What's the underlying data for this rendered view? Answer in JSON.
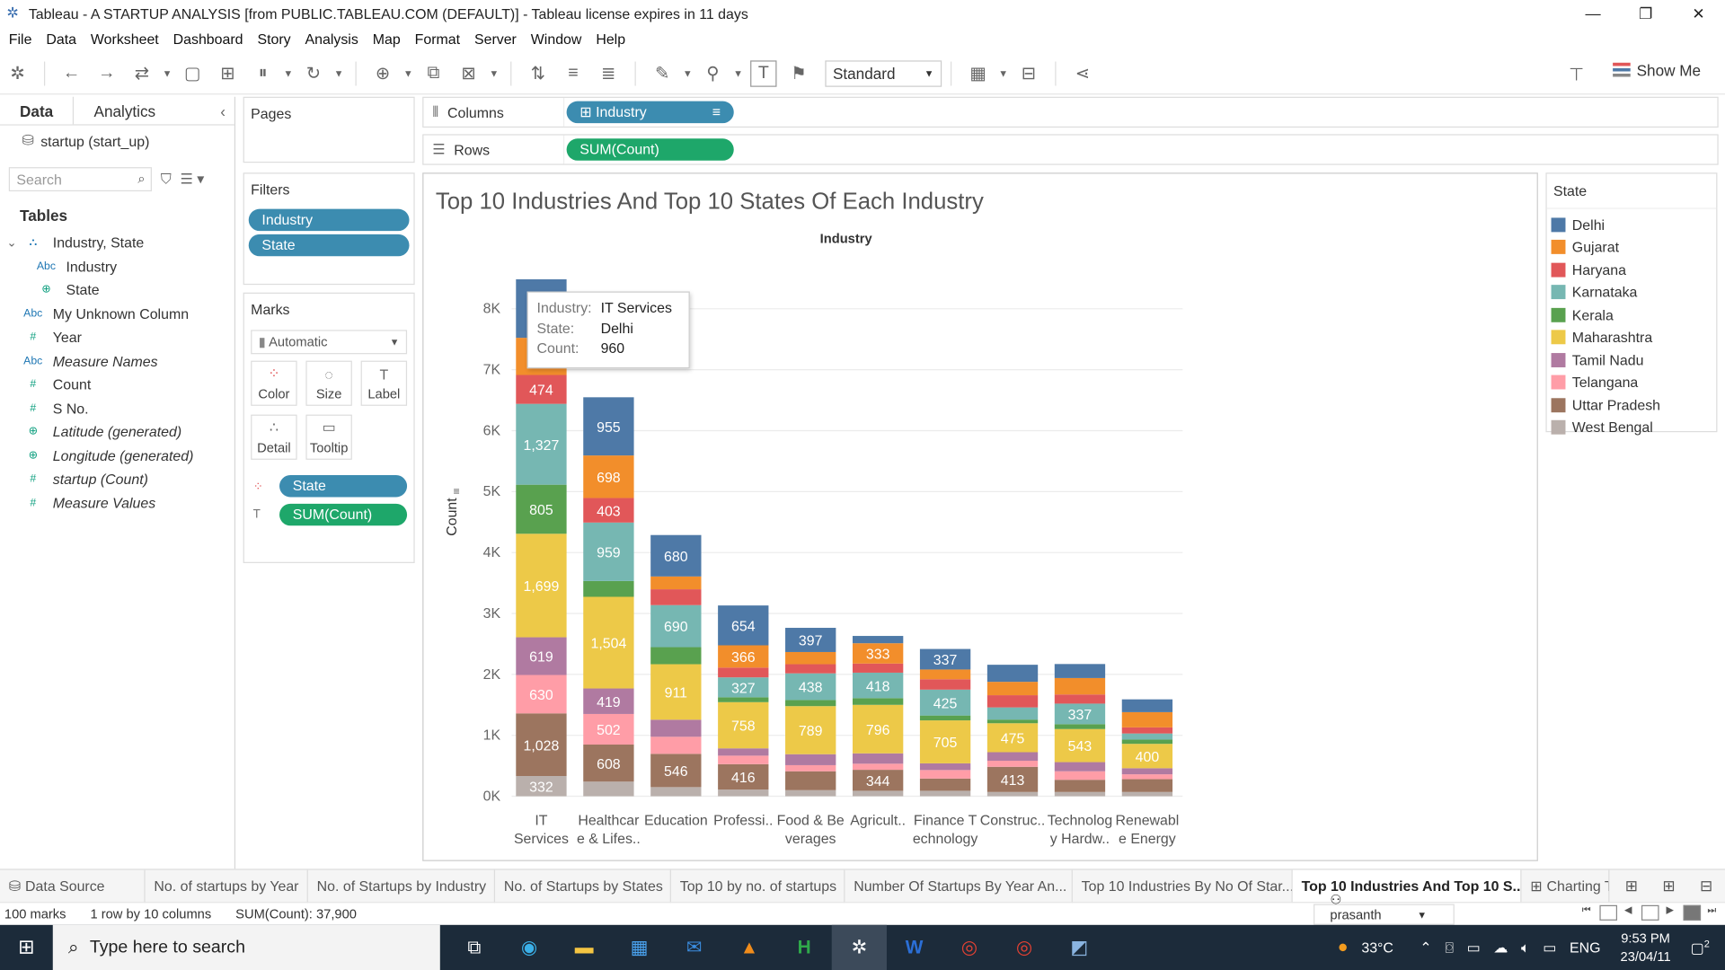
{
  "window": {
    "title": "Tableau - A STARTUP ANALYSIS [from PUBLIC.TABLEAU.COM (DEFAULT)] - Tableau license expires in 11 days",
    "controls": {
      "minimize": "—",
      "restore": "❐",
      "close": "✕"
    }
  },
  "menu": [
    "File",
    "Data",
    "Worksheet",
    "Dashboard",
    "Story",
    "Analysis",
    "Map",
    "Format",
    "Server",
    "Window",
    "Help"
  ],
  "toolbar": {
    "fit_select": "Standard",
    "show_me": "Show Me"
  },
  "data_pane": {
    "tabs": [
      "Data",
      "Analytics"
    ],
    "datasource": "startup (start_up)",
    "search_placeholder": "Search",
    "tables_label": "Tables",
    "fields": [
      {
        "icon": "hierarchy",
        "label": "Industry, State",
        "indent": 0
      },
      {
        "icon": "Abc",
        "label": "Industry",
        "indent": 1
      },
      {
        "icon": "globe",
        "label": "State",
        "indent": 1
      },
      {
        "icon": "Abc",
        "label": "My Unknown Column",
        "indent": 0
      },
      {
        "icon": "#",
        "label": "Year",
        "indent": 0
      },
      {
        "icon": "Abc",
        "label": "Measure Names",
        "indent": 0,
        "italic": true
      },
      {
        "icon": "#",
        "label": "Count",
        "indent": 0
      },
      {
        "icon": "#",
        "label": "S No.",
        "indent": 0
      },
      {
        "icon": "globe",
        "label": "Latitude (generated)",
        "indent": 0,
        "italic": true
      },
      {
        "icon": "globe",
        "label": "Longitude (generated)",
        "indent": 0,
        "italic": true
      },
      {
        "icon": "#",
        "label": "startup (Count)",
        "indent": 0,
        "italic": true
      },
      {
        "icon": "#",
        "label": "Measure Values",
        "indent": 0,
        "italic": true
      }
    ]
  },
  "cards": {
    "pages": "Pages",
    "filters": {
      "title": "Filters",
      "pills": [
        "Industry",
        "State"
      ]
    },
    "marks": {
      "title": "Marks",
      "type": "Automatic",
      "buttons": [
        "Color",
        "Size",
        "Label",
        "Detail",
        "Tooltip"
      ],
      "pills": [
        "State",
        "SUM(Count)"
      ]
    }
  },
  "shelves": {
    "columns_label": "Columns",
    "columns_pill": "Industry",
    "rows_label": "Rows",
    "rows_pill": "SUM(Count)"
  },
  "viz": {
    "title": "Top 10 Industries And Top 10 States Of Each Industry",
    "header": "Industry",
    "y_axis_title": "Count"
  },
  "tooltip": {
    "rows": [
      {
        "k": "Industry:",
        "v": "IT Services"
      },
      {
        "k": "State:",
        "v": "Delhi"
      },
      {
        "k": "Count:",
        "v": "960"
      }
    ]
  },
  "legend": {
    "title": "State",
    "items": [
      {
        "label": "Delhi",
        "color": "#4e79a7"
      },
      {
        "label": "Gujarat",
        "color": "#f28e2b"
      },
      {
        "label": "Haryana",
        "color": "#e15759"
      },
      {
        "label": "Karnataka",
        "color": "#76b7b2"
      },
      {
        "label": "Kerala",
        "color": "#59a14f"
      },
      {
        "label": "Maharashtra",
        "color": "#edc948"
      },
      {
        "label": "Tamil Nadu",
        "color": "#b07aa1"
      },
      {
        "label": "Telangana",
        "color": "#ff9da7"
      },
      {
        "label": "Uttar Pradesh",
        "color": "#9c755f"
      },
      {
        "label": "West Bengal",
        "color": "#bab0ac"
      }
    ]
  },
  "chart_data": {
    "type": "bar",
    "stacked": true,
    "title": "Top 10 Industries And Top 10 States Of Each Industry",
    "xlabel": "Industry",
    "ylabel": "Count",
    "ylim": [
      0,
      8700
    ],
    "yticks": [
      0,
      1000,
      2000,
      3000,
      4000,
      5000,
      6000,
      7000,
      8000
    ],
    "ytick_labels": [
      "0K",
      "1K",
      "2K",
      "3K",
      "4K",
      "5K",
      "6K",
      "7K",
      "8K"
    ],
    "categories": [
      [
        "IT",
        "Services"
      ],
      [
        "Healthcar",
        "e & Lifes.."
      ],
      [
        "Education"
      ],
      [
        "Professi.."
      ],
      [
        "Food & Be",
        "verages"
      ],
      [
        "Agricult.."
      ],
      [
        "Finance T",
        "echnology"
      ],
      [
        "Construc.."
      ],
      [
        "Technolog",
        "y Hardw.."
      ],
      [
        "Renewabl",
        "e Energy"
      ]
    ],
    "stack_order_bottom_to_top": [
      "West Bengal",
      "Uttar Pradesh",
      "Telangana",
      "Tamil Nadu",
      "Maharashtra",
      "Kerala",
      "Karnataka",
      "Haryana",
      "Gujarat",
      "Delhi"
    ],
    "series": [
      {
        "name": "West Bengal",
        "values": [
          332,
          240,
          150,
          110,
          100,
          90,
          90,
          70,
          70,
          70
        ],
        "show_labels": [
          true,
          false,
          false,
          false,
          false,
          false,
          false,
          false,
          false,
          false
        ]
      },
      {
        "name": "Uttar Pradesh",
        "values": [
          1028,
          608,
          546,
          416,
          310,
          344,
          200,
          413,
          200,
          210
        ],
        "show_labels": [
          true,
          true,
          true,
          true,
          false,
          true,
          false,
          true,
          false,
          false
        ]
      },
      {
        "name": "Telangana",
        "values": [
          630,
          502,
          280,
          140,
          100,
          100,
          140,
          100,
          140,
          80
        ],
        "show_labels": [
          true,
          true,
          false,
          false,
          false,
          false,
          false,
          false,
          false,
          false
        ]
      },
      {
        "name": "Tamil Nadu",
        "values": [
          619,
          419,
          280,
          120,
          180,
          170,
          110,
          140,
          150,
          100
        ],
        "show_labels": [
          true,
          true,
          false,
          false,
          false,
          false,
          false,
          false,
          false,
          false
        ]
      },
      {
        "name": "Maharashtra",
        "values": [
          1699,
          1504,
          911,
          758,
          789,
          796,
          705,
          475,
          543,
          400
        ],
        "show_labels": [
          true,
          true,
          true,
          true,
          true,
          true,
          true,
          true,
          true,
          true
        ]
      },
      {
        "name": "Kerala",
        "values": [
          805,
          260,
          280,
          80,
          100,
          110,
          80,
          60,
          80,
          70
        ],
        "show_labels": [
          true,
          false,
          false,
          false,
          false,
          false,
          false,
          false,
          false,
          false
        ]
      },
      {
        "name": "Karnataka",
        "values": [
          1327,
          959,
          690,
          327,
          438,
          418,
          425,
          200,
          337,
          100
        ],
        "show_labels": [
          true,
          true,
          true,
          true,
          true,
          true,
          true,
          false,
          true,
          false
        ]
      },
      {
        "name": "Haryana",
        "values": [
          474,
          403,
          260,
          160,
          150,
          150,
          170,
          200,
          150,
          100
        ],
        "show_labels": [
          true,
          true,
          false,
          false,
          false,
          false,
          false,
          false,
          false,
          false
        ]
      },
      {
        "name": "Gujarat",
        "values": [
          610,
          698,
          210,
          366,
          200,
          333,
          160,
          220,
          270,
          250
        ],
        "show_labels": [
          false,
          true,
          false,
          true,
          false,
          true,
          false,
          false,
          false,
          false
        ]
      },
      {
        "name": "Delhi",
        "values": [
          960,
          955,
          680,
          654,
          397,
          120,
          337,
          280,
          230,
          210
        ],
        "show_labels": [
          false,
          true,
          true,
          true,
          true,
          false,
          true,
          false,
          false,
          false
        ]
      }
    ]
  },
  "sheet_tabs": [
    {
      "label": "Data Source",
      "active": false
    },
    {
      "label": "No. of startups by Year",
      "active": false
    },
    {
      "label": "No. of Startups by Industry",
      "active": false
    },
    {
      "label": "No. of Startups by States",
      "active": false
    },
    {
      "label": "Top 10 by no. of startups",
      "active": false
    },
    {
      "label": "Number Of Startups By Year An...",
      "active": false
    },
    {
      "label": "Top 10 Industries By No Of Star...",
      "active": false
    },
    {
      "label": "Top 10 Industries And Top 10 S...",
      "active": true
    },
    {
      "label": "Charting T",
      "active": false
    }
  ],
  "status": {
    "marks": "100 marks",
    "dims": "1 row by 10 columns",
    "sum": "SUM(Count): 37,900",
    "user": "prasanth k"
  },
  "taskbar": {
    "search_placeholder": "Type here to search",
    "weather": "33°C",
    "lang": "ENG",
    "time": "9:53 PM",
    "date": "23/04/11",
    "notif_count": "2"
  }
}
